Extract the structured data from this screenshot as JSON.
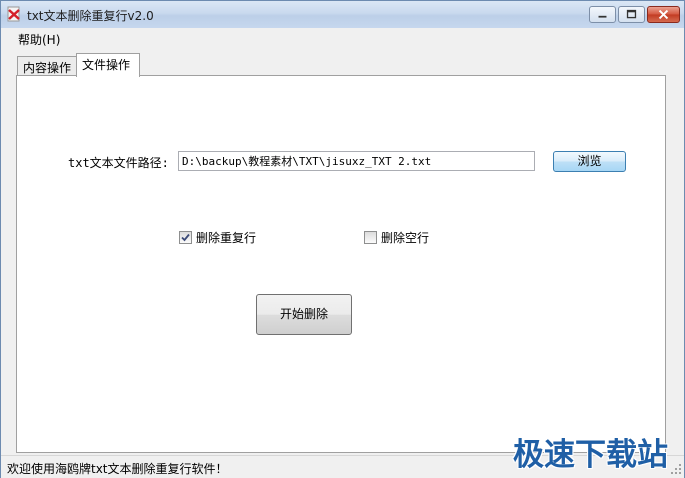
{
  "window": {
    "title": "txt文本删除重复行v2.0"
  },
  "menu": {
    "help": "帮助(H)"
  },
  "tabs": [
    {
      "label": "内容操作"
    },
    {
      "label": "文件操作"
    }
  ],
  "file_panel": {
    "path_label": "txt文本文件路径:",
    "path_value": "D:\\backup\\教程素材\\TXT\\jisuxz_TXT 2.txt",
    "browse_label": "浏览",
    "option_dedupe": {
      "label": "删除重复行",
      "checked": true
    },
    "option_blank": {
      "label": "删除空行",
      "checked": false
    },
    "start_label": "开始删除"
  },
  "status": {
    "text": "欢迎使用海鸥牌txt文本删除重复行软件！"
  },
  "watermark": "极速下载站",
  "colors": {
    "accent": "#3c7fb1",
    "watermark": "#1f5fa6",
    "close": "#c23b22"
  }
}
